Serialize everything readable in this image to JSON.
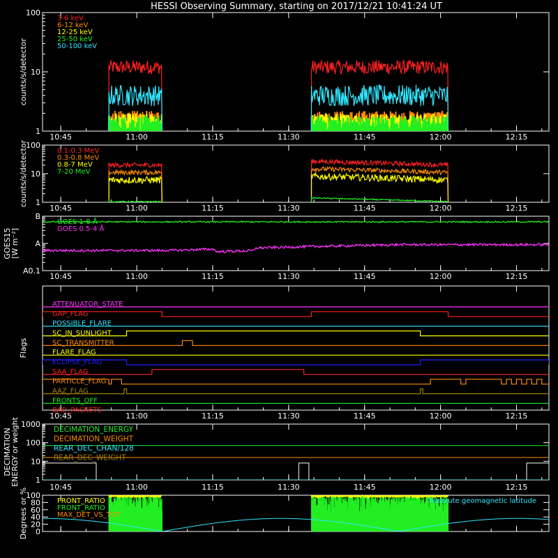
{
  "title": "HESSI Observing Summary, starting on 2017/12/21 10:41:24 UT",
  "time_ticks": [
    "10:45",
    "11:00",
    "11:15",
    "11:30",
    "11:45",
    "12:00",
    "12:15"
  ],
  "colors": {
    "background": "#000000",
    "axes": "#ffffff",
    "red": "#ff2020",
    "orange": "#ff8c00",
    "yellow": "#ffff00",
    "green": "#22ee22",
    "cyan": "#30e8ff",
    "magenta": "#ff33ff",
    "blue": "#2020ff",
    "olive": "#a08000",
    "pink": "#ff7070"
  },
  "chart_data": [
    {
      "id": "panel1",
      "type": "line",
      "ylabel": "counts/s/detector",
      "yscale": "log",
      "ylim": [
        1,
        100
      ],
      "y_ticks": [
        {
          "value": 1,
          "label": "1"
        },
        {
          "value": 10,
          "label": "10"
        },
        {
          "value": 100,
          "label": "100"
        }
      ],
      "xlim": [
        "10:41:24",
        "12:21:24"
      ],
      "series": [
        {
          "name": "3-6 keV",
          "color": "#ff2020",
          "kind": "noisy",
          "level": 12,
          "jitter": 0.12
        },
        {
          "name": "6-12 keV",
          "color": "#ff8c00",
          "kind": "spiky",
          "base": 1.2,
          "top": 2.2
        },
        {
          "name": "12-25 keV",
          "color": "#ffff00",
          "kind": "spiky",
          "base": 1.0,
          "top": 2.0
        },
        {
          "name": "25-50 keV",
          "color": "#22ee22",
          "kind": "spiky",
          "base": 1.0,
          "top": 1.8
        },
        {
          "name": "50-100 keV",
          "color": "#30e8ff",
          "kind": "noisy",
          "level": 4,
          "jitter": 0.18
        }
      ],
      "data_intervals": [
        [
          "10:54:30",
          "11:05:00"
        ],
        [
          "11:34:30",
          "12:01:30"
        ]
      ]
    },
    {
      "id": "panel2",
      "type": "line",
      "ylabel": "counts/s/detector",
      "yscale": "log",
      "ylim": [
        1,
        100
      ],
      "y_ticks": [
        {
          "value": 1,
          "label": "1"
        },
        {
          "value": 10,
          "label": "10"
        },
        {
          "value": 100,
          "label": "100"
        }
      ],
      "xlim": [
        "10:41:24",
        "12:21:24"
      ],
      "series": [
        {
          "name": "0.1-0.3 MeV",
          "color": "#ff2020",
          "kind": "noisy",
          "level": 20,
          "jitter": 0.08
        },
        {
          "name": "0.3-0.8 MeV",
          "color": "#ff8c00",
          "kind": "noisy",
          "level": 11,
          "jitter": 0.08
        },
        {
          "name": "0.8-7 MeV",
          "color": "#ffff00",
          "kind": "noisy",
          "level": 6,
          "jitter": 0.12
        },
        {
          "name": "7-20 MeV",
          "color": "#22ee22",
          "kind": "noisy",
          "level": 1.05,
          "jitter": 0.02
        }
      ],
      "data_intervals": [
        [
          "10:54:30",
          "11:05:00"
        ],
        [
          "11:34:30",
          "12:01:30"
        ]
      ]
    },
    {
      "id": "panel3",
      "type": "line",
      "ylabel": "GOES15",
      "ylabel2": "[W m⁻²]",
      "yscale": "log",
      "ylim": [
        0.1,
        10
      ],
      "y_ticks": [
        {
          "value": 10,
          "label": "B"
        },
        {
          "value": 1,
          "label": "A"
        },
        {
          "value": 0.1,
          "label": "A0.1"
        }
      ],
      "xlim": [
        "10:41:24",
        "12:21:24"
      ],
      "series": [
        {
          "name": "GOES 1-8 Å",
          "color": "#22ee22",
          "kind": "goes_long"
        },
        {
          "name": "GOES 0.5-4 Å",
          "color": "#ff33ff",
          "kind": "goes_short"
        }
      ]
    },
    {
      "id": "panel4",
      "type": "flags",
      "ylabel": "Flags",
      "xlim": [
        "10:41:24",
        "12:21:24"
      ],
      "flags": [
        {
          "name": "ATTENUATOR_STATE",
          "color": "#ff33ff",
          "high": []
        },
        {
          "name": "GAP_FLAG",
          "color": "#ff2020",
          "high": [
            [
              "10:41:24",
              "11:05:00"
            ],
            [
              "11:34:30",
              "12:01:30"
            ]
          ]
        },
        {
          "name": "POSSIBLE_FLARE",
          "color": "#30e8ff",
          "high": []
        },
        {
          "name": "SC_IN_SUNLIGHT",
          "color": "#ffff00",
          "high": [
            [
              "10:58:00",
              "11:56:00"
            ]
          ]
        },
        {
          "name": "SC_TRANSMITTER",
          "color": "#ff8c00",
          "high": [
            [
              "11:09:00",
              "11:11:00"
            ]
          ]
        },
        {
          "name": "FLARE_FLAG",
          "color": "#ffff00",
          "high": []
        },
        {
          "name": "ECLIPSE_FLAG",
          "color": "#2020ff",
          "high": [
            [
              "10:41:24",
              "10:58:00"
            ],
            [
              "11:56:00",
              "12:21:24"
            ]
          ]
        },
        {
          "name": "SAA_FLAG",
          "color": "#ff2020",
          "high": [
            [
              "11:03:00",
              "11:33:00"
            ]
          ]
        },
        {
          "name": "PARTICLE_FLAG",
          "color": "#ff8c00",
          "high": [
            [
              "10:41:24",
              "10:54:30"
            ],
            [
              "10:55:00",
              "10:57:00"
            ],
            [
              "11:58:00",
              "12:04:00"
            ],
            [
              "12:05:00",
              "12:12:00"
            ],
            [
              "12:13:00",
              "12:14:00"
            ],
            [
              "12:15:00",
              "12:16:00"
            ],
            [
              "12:17:00",
              "12:18:00"
            ],
            [
              "12:19:00",
              "12:20:00"
            ]
          ]
        },
        {
          "name": "AAZ_FLAG",
          "color": "#a08000",
          "high": [
            [
              "10:57:30",
              "10:58:00"
            ],
            [
              "11:56:00",
              "11:56:30"
            ]
          ]
        },
        {
          "name": "FRONTS_OFF",
          "color": "#22ee22",
          "high": []
        },
        {
          "name": "BAD_PACKETS",
          "color": "#ff2020",
          "high": []
        }
      ]
    },
    {
      "id": "panel5",
      "type": "line",
      "ylabel": "DECIMATION",
      "ylabel2": "ENERGY or weight",
      "yscale": "log",
      "ylim": [
        1,
        1000
      ],
      "y_ticks": [
        {
          "value": 1,
          "label": "1"
        },
        {
          "value": 10,
          "label": "10"
        },
        {
          "value": 100,
          "label": "100"
        },
        {
          "value": 1000,
          "label": "1000"
        }
      ],
      "xlim": [
        "10:41:24",
        "12:21:24"
      ],
      "series": [
        {
          "name": "DECIMATION_ENERGY",
          "color": "#22ee22",
          "kind": "const",
          "level": 70
        },
        {
          "name": "DECIMATION_WEIGHT",
          "color": "#ff8c00",
          "kind": "const",
          "level": 16
        },
        {
          "name": "REAR_DEC_CHAN/128",
          "color": "#30e8ff",
          "kind": "const",
          "level": 1
        },
        {
          "name": "REAR_DEC_WEIGHT",
          "color": "#a08000",
          "kind": "steps",
          "steps": [
            [
              "10:41:24",
              "10:52:00",
              8
            ],
            [
              "11:32:00",
              "11:34:00",
              8
            ],
            [
              "12:17:00",
              "12:21:24",
              8
            ]
          ]
        }
      ]
    },
    {
      "id": "panel6",
      "type": "line",
      "ylabel": "Degrees or %",
      "yscale": "linear",
      "ylim": [
        0,
        100
      ],
      "y_ticks": [
        {
          "value": 0,
          "label": "0"
        },
        {
          "value": 20,
          "label": "20"
        },
        {
          "value": 40,
          "label": "40"
        },
        {
          "value": 60,
          "label": "60"
        },
        {
          "value": 80,
          "label": "80"
        },
        {
          "value": 100,
          "label": "100"
        }
      ],
      "xlim": [
        "10:41:24",
        "12:21:24"
      ],
      "series": [
        {
          "name": "FRONT_RATIO",
          "color": "#ffff00",
          "kind": "ratio_top"
        },
        {
          "name": "FRONT_RATIO",
          "color": "#22ee22",
          "kind": "ratio_bars"
        },
        {
          "name": "MAX_DET_VS_TOT",
          "color": "#ff8c00",
          "kind": "none"
        },
        {
          "name": "Absolute geomagnetic latitude",
          "color": "#30e8ff",
          "kind": "latitude"
        }
      ],
      "data_intervals": [
        [
          "10:54:30",
          "11:05:00"
        ],
        [
          "11:34:30",
          "12:01:30"
        ]
      ]
    }
  ]
}
